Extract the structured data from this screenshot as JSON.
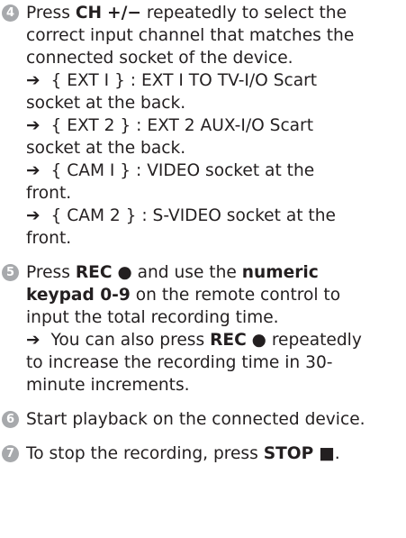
{
  "steps": [
    {
      "number": "4",
      "lines": [
        [
          "Press ",
          "CH",
          " ",
          "+/−",
          " repeatedly to select the"
        ],
        [
          "correct input channel that matches the"
        ],
        [
          "connected socket of the device."
        ],
        [
          "➔",
          " { EXT I } : EXT I TO TV-I/O Scart"
        ],
        [
          "socket at the back."
        ],
        [
          "➔",
          " { EXT 2 } : EXT 2 AUX-I/O Scart"
        ],
        [
          "socket at the back."
        ],
        [
          "➔",
          " { CAM I } : VIDEO socket at the"
        ],
        [
          "front."
        ],
        [
          "➔",
          " { CAM 2 } : S-VIDEO socket at the"
        ],
        [
          "front."
        ]
      ]
    },
    {
      "number": "5",
      "lines": [
        [
          "Press ",
          "REC",
          " ",
          "●",
          " and use the ",
          "numeric"
        ],
        [
          "keypad 0-9",
          " on the remote control to"
        ],
        [
          "input the total recording time."
        ],
        [
          "➔",
          " You can also press ",
          "REC",
          " ",
          "●",
          " repeatedly"
        ],
        [
          "to increase the recording time in 30-"
        ],
        [
          "minute increments."
        ]
      ]
    },
    {
      "number": "6",
      "lines": [
        [
          "Start playback on the connected device."
        ]
      ]
    },
    {
      "number": "7",
      "lines": [
        [
          "To stop the recording, press ",
          "STOP",
          " ",
          "■",
          "."
        ]
      ]
    }
  ]
}
